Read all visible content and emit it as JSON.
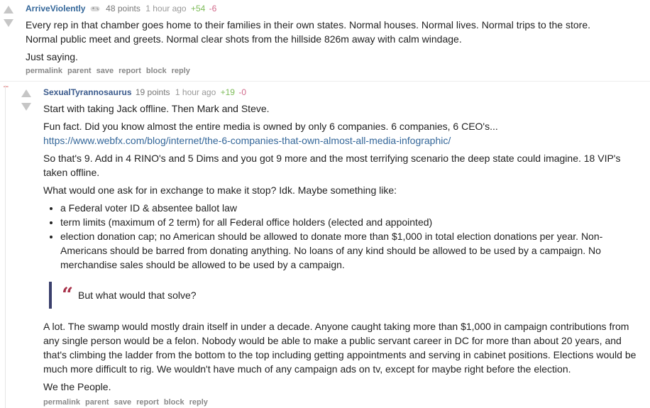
{
  "comments": [
    {
      "author": "ArriveViolently",
      "points": "48 points",
      "time": "1 hour ago",
      "plus": "+54",
      "minus": "-6",
      "paragraphs": [
        "Every rep in that chamber goes home to their families in their own states. Normal houses. Normal lives. Normal trips to the store.",
        "Normal public meet and greets. Normal clear shots from the hillside 826m away with calm windage.",
        "Just saying."
      ],
      "buttons": [
        "permalink",
        "parent",
        "save",
        "report",
        "block",
        "reply"
      ]
    },
    {
      "collapse_symbol": "–",
      "author": "SexualTyrannosaurus",
      "points": "19 points",
      "time": "1 hour ago",
      "plus": "+19",
      "minus": "-0",
      "p1": "Start with taking Jack offline. Then Mark and Steve.",
      "p2": "Fun fact. Did you know almost the entire media is owned by only 6 companies. 6 companies, 6 CEO's...",
      "link": "https://www.webfx.com/blog/internet/the-6-companies-that-own-almost-all-media-infographic/",
      "p3_line1": "So that's 9. Add in 4 RINO's and 5 Dims and you got 9 more and the most terrifying scenario the deep state could imagine. 18 VIP's",
      "p3_line2": "taken offline.",
      "p4": "What would one ask for in exchange to make it stop? Idk. Maybe something like:",
      "list": [
        "a Federal voter ID & absentee ballot law",
        "term limits (maximum of 2 term) for all Federal office holders (elected and appointed)",
        "election donation cap; no American should be allowed to donate more than $1,000 in total election donations per year. Non-Americans should be barred from donating anything. No loans of any kind should be allowed to be used by a campaign. No merchandise sales should be allowed to be used by a campaign."
      ],
      "quote_mark": "“",
      "quote": "But what would that solve?",
      "p5": "A lot. The swamp would mostly drain itself in under a decade. Anyone caught taking more than $1,000 in campaign contributions from any single person would be a felon. Nobody would be able to make a public servant career in DC for more than about 20 years, and that's climbing the ladder from the bottom to the top including getting appointments and serving in cabinet positions. Elections would be much more difficult to rig. We wouldn't have much of any campaign ads on tv, except for maybe right before the election.",
      "p6": "We the People.",
      "buttons": [
        "permalink",
        "parent",
        "save",
        "report",
        "block",
        "reply"
      ]
    }
  ],
  "colors": {
    "author_link": "#336699",
    "upvotes": "#7dbb58",
    "downvotes": "#d16a8b",
    "quote_bar": "#3a3f6c",
    "quote_mark": "#a8324a"
  },
  "icons": {
    "vote_up": "up-arrow-icon",
    "vote_down": "down-arrow-icon",
    "flair": "gamepad-icon"
  }
}
